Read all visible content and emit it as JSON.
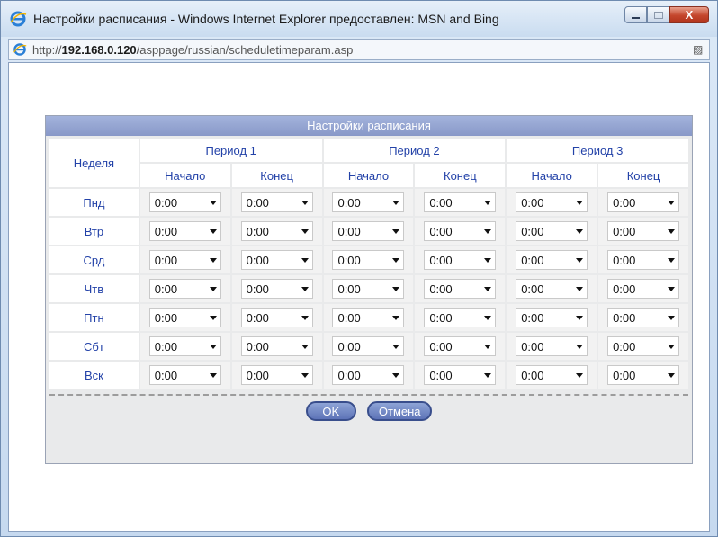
{
  "window": {
    "title": "Настройки расписания - Windows Internet Explorer предоставлен: MSN and Bing",
    "close_label": "X"
  },
  "address": {
    "prefix": "http://",
    "host": "192.168.0.120",
    "path": "/asppage/russian/scheduletimeparam.asp"
  },
  "panel": {
    "title": "Настройки расписания",
    "week_header": "Неделя",
    "periods": [
      "Период 1",
      "Период 2",
      "Период 3"
    ],
    "start_label": "Начало",
    "end_label": "Конец",
    "days": [
      "Пнд",
      "Втр",
      "Срд",
      "Чтв",
      "Птн",
      "Сбт",
      "Вск"
    ],
    "default_time": "0:00",
    "ok_label": "OK",
    "cancel_label": "Отмена"
  },
  "colors": {
    "header_text": "#2342a8",
    "panel_title_bg": "#8898c8",
    "button_bg": "#5d73b7"
  }
}
